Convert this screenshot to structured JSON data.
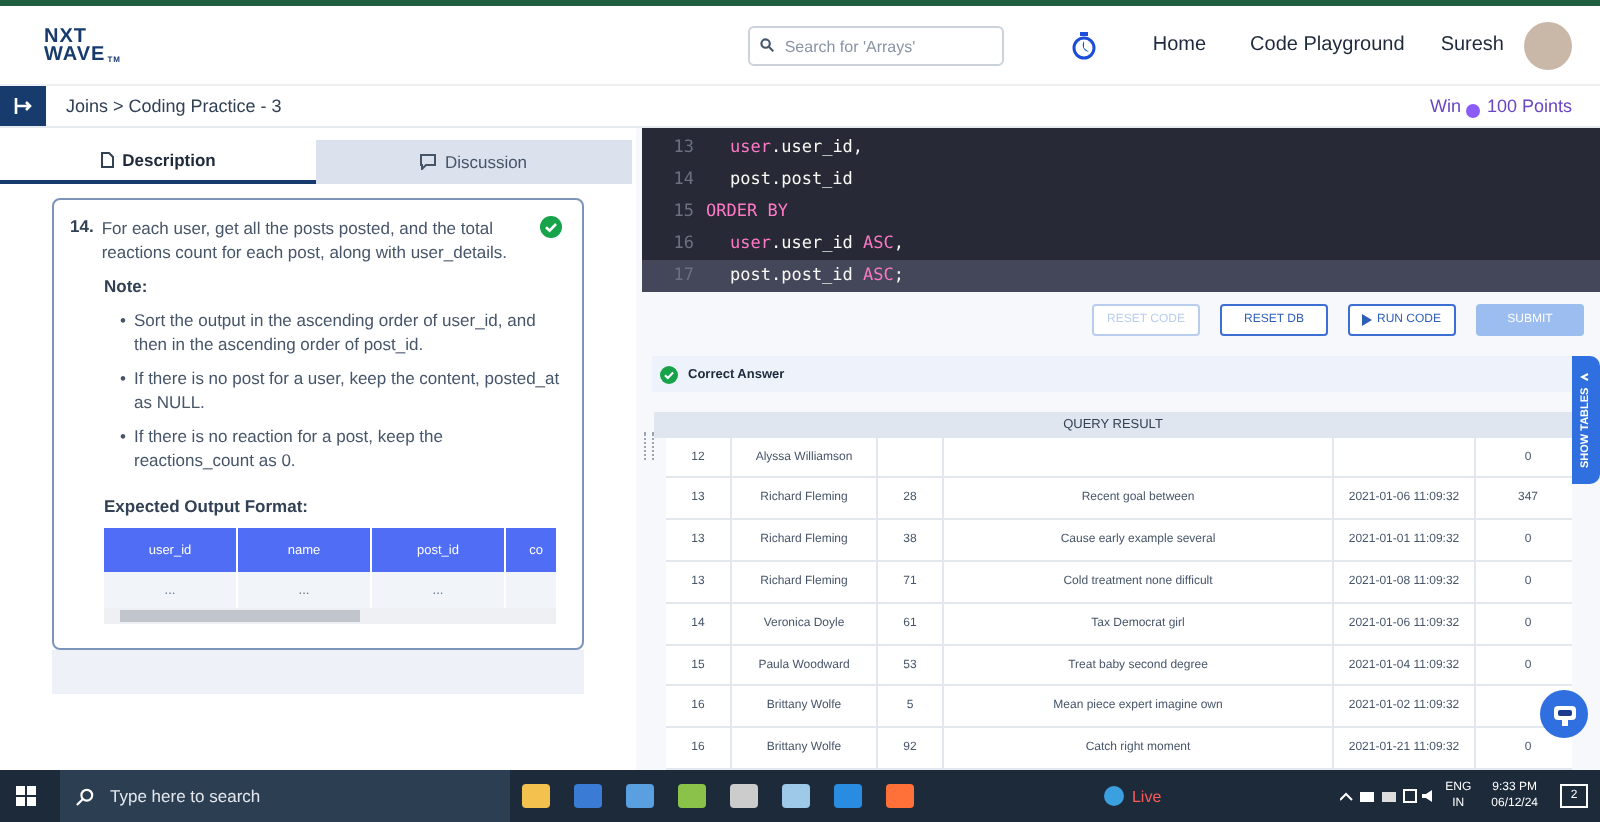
{
  "header": {
    "logo_top": "NXT",
    "logo_bottom": "WAVE",
    "logo_mark": "TM",
    "search": {
      "placeholder": "Search for 'Arrays'"
    },
    "nav": [
      "Home",
      "Code Playground"
    ],
    "user": "Suresh"
  },
  "subheader": {
    "breadcrumb": "Joins > Coding Practice - 3",
    "win_label": "Win",
    "points": "100 Points"
  },
  "tabs": [
    {
      "label": "Description",
      "selected": true
    },
    {
      "label": "Discussion",
      "selected": false
    }
  ],
  "question": {
    "number": "14.",
    "text": "For each user, get all the posts posted, and the total reactions count for each post, along with user_details.",
    "solved": true,
    "note_title": "Note:",
    "bullet": "•",
    "notes": [
      "Sort the output in the ascending order of user_id, and then in the ascending order of post_id.",
      "If there is no post for a user, keep the content, posted_at as NULL.",
      "If there is no reaction for a post, keep the reactions_count as 0."
    ],
    "format_title": "Expected Output Format:",
    "format_columns": [
      "user_id",
      "name",
      "post_id",
      "co"
    ],
    "format_row": [
      "...",
      "...",
      "..."
    ]
  },
  "code": [
    {
      "num": "13",
      "indent": true,
      "current": false,
      "tokens": [
        {
          "t": "user",
          "kind": "table"
        },
        {
          "t": ".user_id,",
          "kind": "plain"
        }
      ]
    },
    {
      "num": "14",
      "indent": true,
      "current": false,
      "tokens": [
        {
          "t": "post.post_id",
          "kind": "plain"
        }
      ]
    },
    {
      "num": "15",
      "indent": false,
      "current": false,
      "tokens": [
        {
          "t": "ORDER BY",
          "kind": "keyword"
        }
      ]
    },
    {
      "num": "16",
      "indent": true,
      "current": false,
      "tokens": [
        {
          "t": "user",
          "kind": "table"
        },
        {
          "t": ".user_id ",
          "kind": "plain"
        },
        {
          "t": "ASC",
          "kind": "keyword"
        },
        {
          "t": ",",
          "kind": "plain"
        }
      ]
    },
    {
      "num": "17",
      "indent": true,
      "current": true,
      "tokens": [
        {
          "t": "post.post_id ",
          "kind": "plain"
        },
        {
          "t": "ASC",
          "kind": "keyword"
        },
        {
          "t": ";",
          "kind": "plain"
        }
      ]
    }
  ],
  "buttons": [
    {
      "label": "RESET CODE",
      "kind": "outline",
      "disabled": true
    },
    {
      "label": "RESET DB",
      "kind": "outline",
      "disabled": false
    },
    {
      "label": "RUN CODE",
      "kind": "run",
      "disabled": false
    },
    {
      "label": "SUBMIT",
      "kind": "primary",
      "disabled": true
    }
  ],
  "result": {
    "status": "Correct Answer",
    "correct": true,
    "title": "QUERY RESULT",
    "side_tab": "SHOW TABLES",
    "rows": [
      [
        "12",
        "Alyssa Williamson",
        "",
        "",
        "",
        "0"
      ],
      [
        "13",
        "Richard Fleming",
        "28",
        "Recent goal between",
        "2021-01-06 11:09:32",
        "347"
      ],
      [
        "13",
        "Richard Fleming",
        "38",
        "Cause early example several",
        "2021-01-01 11:09:32",
        "0"
      ],
      [
        "13",
        "Richard Fleming",
        "71",
        "Cold treatment none difficult",
        "2021-01-08 11:09:32",
        "0"
      ],
      [
        "14",
        "Veronica Doyle",
        "61",
        "Tax Democrat girl",
        "2021-01-06 11:09:32",
        "0"
      ],
      [
        "15",
        "Paula Woodward",
        "53",
        "Treat baby second degree",
        "2021-01-04 11:09:32",
        "0"
      ],
      [
        "16",
        "Brittany Wolfe",
        "5",
        "Mean piece expert imagine own",
        "2021-01-02 11:09:32",
        ""
      ],
      [
        "16",
        "Brittany Wolfe",
        "92",
        "Catch right moment",
        "2021-01-21 11:09:32",
        "0"
      ]
    ]
  },
  "taskbar": {
    "search_placeholder": "Type here to search",
    "weather": "Live",
    "lang_top": "ENG",
    "lang_bottom": "IN",
    "time": "9:33 PM",
    "date": "06/12/24",
    "notifications": "2"
  }
}
